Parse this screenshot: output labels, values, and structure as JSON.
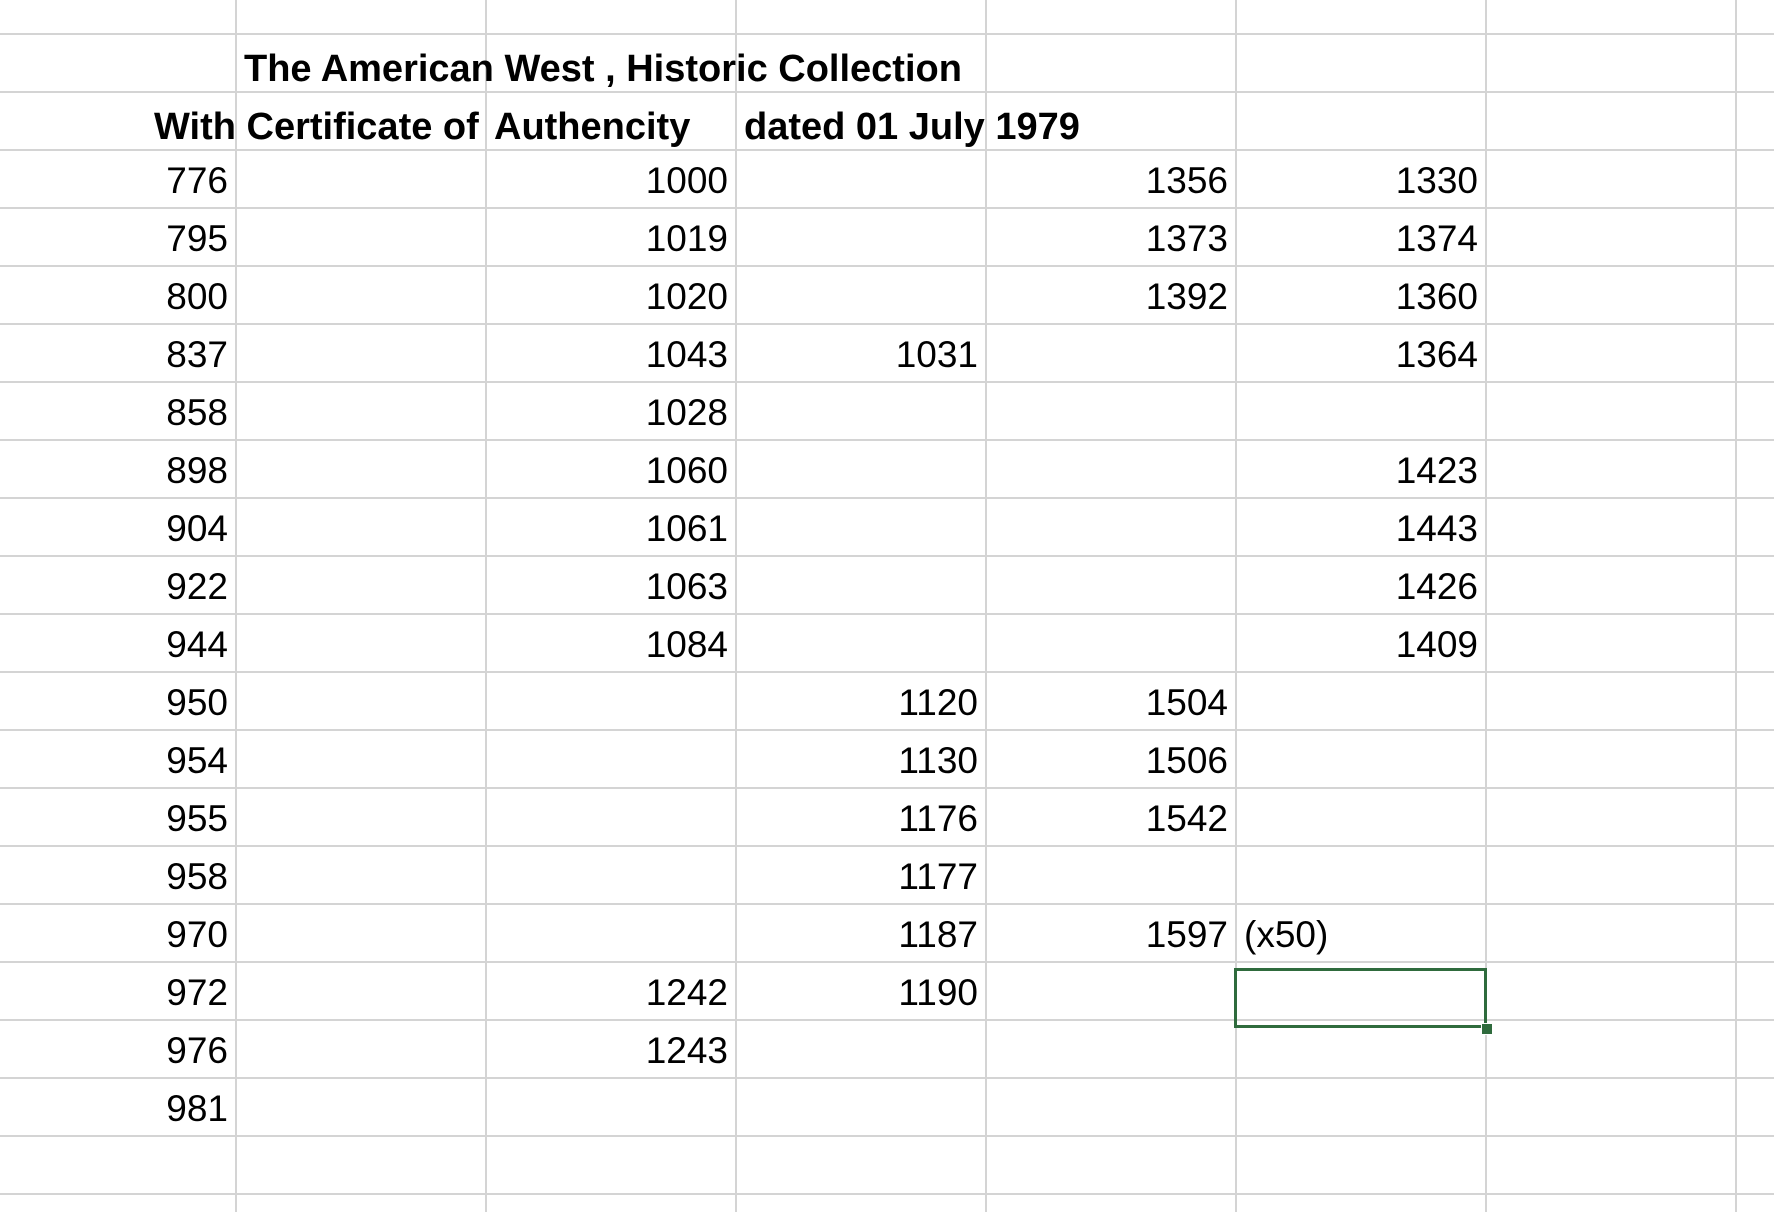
{
  "title_row": {
    "line1": "The American West , Historic  Collection",
    "line2_a": "With Certificate of",
    "line2_b": "Authencity",
    "line2_c": "dated 01 July 1979"
  },
  "rows": [
    [
      "776",
      "",
      "1000",
      "",
      "1356",
      "1330"
    ],
    [
      "795",
      "",
      "1019",
      "",
      "1373",
      "1374"
    ],
    [
      "800",
      "",
      "1020",
      "",
      "1392",
      "1360"
    ],
    [
      "837",
      "",
      "1043",
      "1031",
      "",
      "1364"
    ],
    [
      "858",
      "",
      "1028",
      "",
      "",
      ""
    ],
    [
      "898",
      "",
      "1060",
      "",
      "",
      "1423"
    ],
    [
      "904",
      "",
      "1061",
      "",
      "",
      "1443"
    ],
    [
      "922",
      "",
      "1063",
      "",
      "",
      "1426"
    ],
    [
      "944",
      "",
      "1084",
      "",
      "",
      "1409"
    ],
    [
      "950",
      "",
      "",
      "1120",
      "1504",
      ""
    ],
    [
      "954",
      "",
      "",
      "1130",
      "1506",
      ""
    ],
    [
      "955",
      "",
      "",
      "1176",
      "1542",
      ""
    ],
    [
      "958",
      "",
      "",
      "1177",
      "",
      ""
    ],
    [
      "970",
      "",
      "",
      "1187",
      "1597",
      "(x50)"
    ],
    [
      "972",
      "",
      "1242",
      "1190",
      "",
      ""
    ],
    [
      "976",
      "",
      "1243",
      "",
      "",
      ""
    ],
    [
      "981",
      "",
      "",
      "",
      "",
      ""
    ]
  ],
  "selection": {
    "row": 15,
    "column": 6
  }
}
